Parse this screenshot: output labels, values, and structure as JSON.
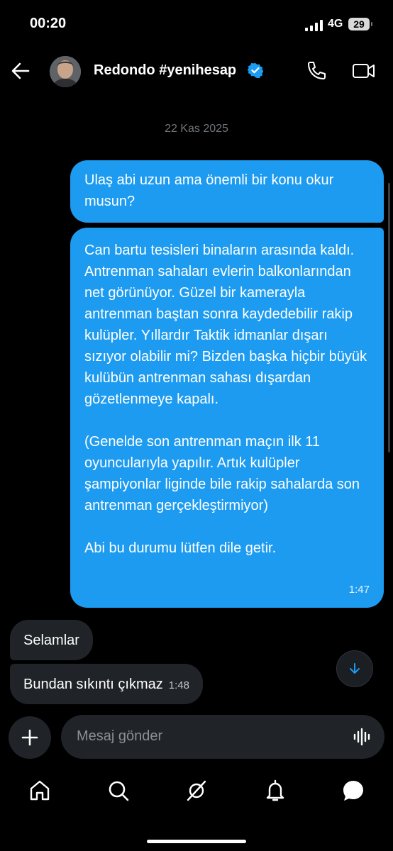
{
  "status_bar": {
    "time": "00:20",
    "network": "4G",
    "battery": "29"
  },
  "header": {
    "name": "Redondo #yenihesap",
    "verified_icon": "verified-badge-icon",
    "accent": "#1d9bf0"
  },
  "date_separator": "22 Kas 2025",
  "messages": [
    {
      "direction": "outgoing",
      "paragraphs": [
        "Ulaş abi uzun ama önemli bir konu okur musun?"
      ]
    },
    {
      "direction": "outgoing",
      "paragraphs": [
        "Can bartu tesisleri binaların arasında kaldı. Antrenman sahaları evlerin balkonlarından net görünüyor. Güzel bir kamerayla antrenman baştan sonra kaydedebilir rakip kulüpler. Yıllardır Taktik idmanlar dışarı sızıyor olabilir mi? Bizden başka hiçbir büyük kulübün antrenman sahası dışardan gözetlenmeye kapalı.",
        "(Genelde son antrenman maçın ilk 11 oyuncularıyla yapılır. Artık kulüpler şampiyonlar liginde bile rakip sahalarda son antrenman gerçekleştirmiyor)",
        "Abi bu durumu lütfen dile getir."
      ],
      "time": "1:47"
    },
    {
      "direction": "incoming",
      "text": "Selamlar"
    },
    {
      "direction": "incoming",
      "text": "Bundan sıkıntı çıkmaz",
      "time": "1:48"
    }
  ],
  "composer": {
    "placeholder": "Mesaj gönder"
  },
  "tabs": [
    "home-icon",
    "search-icon",
    "grok-icon",
    "notifications-icon",
    "messages-icon"
  ],
  "colors": {
    "background": "#000000",
    "outgoing_bubble": "#1d9bf0",
    "incoming_bubble": "#202327"
  }
}
